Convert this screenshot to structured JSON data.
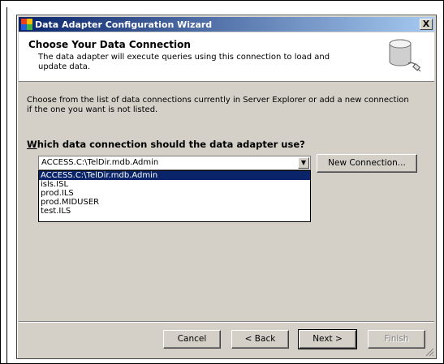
{
  "window": {
    "title": "Data Adapter Configuration Wizard",
    "close_glyph": "X"
  },
  "header": {
    "title": "Choose Your Data Connection",
    "subtitle": "The data adapter will execute queries using this connection to load and update data.",
    "icon": "database-plug-icon"
  },
  "body": {
    "intro": "Choose from the list of data connections currently in Server Explorer or add a new connection if the one you want is not listed.",
    "question_accel": "W",
    "question_rest": "hich data connection should the data adapter use?"
  },
  "connection_combo": {
    "value": "ACCESS.C:\\TelDir.mdb.Admin",
    "options": [
      "ACCESS.C:\\TelDir.mdb.Admin",
      "isls.ISL",
      "prod.ILS",
      "prod.MIDUSER",
      "test.ILS"
    ],
    "selected_index": 0
  },
  "buttons": {
    "new_connection": "New Connection...",
    "cancel": "Cancel",
    "back": "< Back",
    "next": "Next >",
    "finish": "Finish"
  },
  "colors": {
    "title_gradient_start": "#0a246a",
    "title_gradient_end": "#a6caf0",
    "dialog_face": "#d4d0c8",
    "selection": "#0a246a"
  }
}
